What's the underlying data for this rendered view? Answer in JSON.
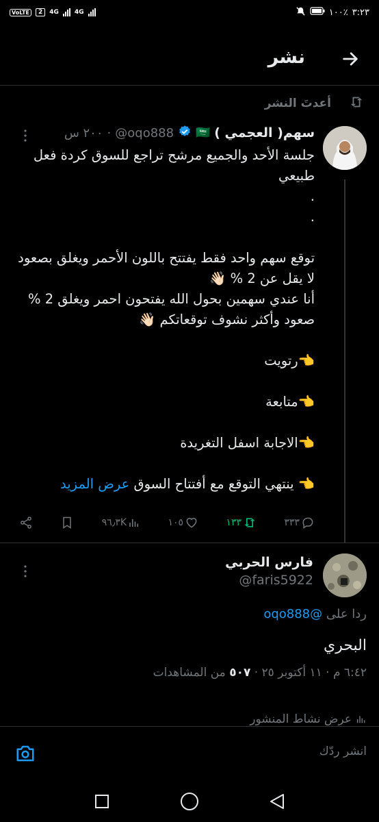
{
  "status_bar": {
    "time": "٣:٢٣",
    "battery": "١٠٠٪",
    "volte": "VoLTE",
    "sim_badge": "2",
    "network_1": "4G",
    "network_2": "4G"
  },
  "header": {
    "title": "نشر"
  },
  "repost": {
    "label": "أعدتَ النشر"
  },
  "tweet": {
    "display_name": "سهم( العجمي )",
    "flag": "🇸🇦",
    "handle": "@oqo888",
    "time": "٢٠٠ س",
    "lines": {
      "l1": "جلسة الأحد والجميع مرشح تراجع للسوق كردة فعل طبيعي",
      "dot1": ".",
      "dot2": ".",
      "l2": "توقع سهم واحد فقط يفتتح باللون الأحمر ويغلق بصعود",
      "l3": "لا يقل عن 2 % 👋🏻",
      "l4": "أنا عندي سهمين بحول الله يفتحون احمر ويغلق 2 % صعود وأكثر نشوف توقعاتكم 👋🏻",
      "l5": "👈رتويت",
      "l6": "👈متابعة",
      "l7": "👈الاجابة اسفل  التغريدة",
      "l8": "👈 ينتهي التوقع مع أفتتاح السوق",
      "show_more": "عرض المزيد"
    },
    "stats": {
      "replies": "٣٣٣",
      "reposts": "١٣٣",
      "likes": "١٠٥",
      "views": "٩٦٫٣K"
    }
  },
  "reply": {
    "display_name": "فارس الحربي",
    "handle": "@faris5922",
    "replying_to_prefix": "ردا على",
    "replying_to_handle": "@oqo888",
    "text": "البحري",
    "timestamp": "٦:٤٢ م · ١١ أكتوبر ٢٥ ·",
    "views_count": "٥٠٧",
    "views_label": "من المشاهدات",
    "activity_label": "عرض نشاط المنشور"
  },
  "composer": {
    "placeholder": "انشر ردّك"
  },
  "colors": {
    "background": "#000000",
    "text": "#e7e9ea",
    "muted": "#71767b",
    "accent": "#1d9bf0",
    "repost_active": "#00ba7c",
    "verified": "#1d9bf0"
  },
  "icons": {
    "back": "arrow-right-icon",
    "repost": "repost-icon",
    "verified": "verified-badge-icon",
    "more": "more-dots-icon",
    "reply": "reply-icon",
    "like": "heart-icon",
    "views": "views-icon",
    "bookmark": "bookmark-icon",
    "share": "share-icon",
    "camera": "camera-icon"
  }
}
